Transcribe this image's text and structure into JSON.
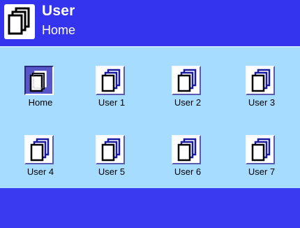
{
  "header": {
    "title": "User",
    "subtitle": "Home",
    "icon": "user-profiles-icon"
  },
  "tiles": [
    {
      "label": "Home",
      "icon": "home-profile-icon",
      "selected": true
    },
    {
      "label": "User 1",
      "icon": "user-profile-icon",
      "selected": false
    },
    {
      "label": "User 2",
      "icon": "user-profile-icon",
      "selected": false
    },
    {
      "label": "User 3",
      "icon": "user-profile-icon",
      "selected": false
    },
    {
      "label": "User 4",
      "icon": "user-profile-icon",
      "selected": false
    },
    {
      "label": "User 5",
      "icon": "user-profile-icon",
      "selected": false
    },
    {
      "label": "User 6",
      "icon": "user-profile-icon",
      "selected": false
    },
    {
      "label": "User 7",
      "icon": "user-profile-icon",
      "selected": false
    }
  ],
  "colors": {
    "header_bg": "#3434ee",
    "content_bg": "#a6dcff",
    "footer_bg": "#3a3af0",
    "selected_tile": "#5656c8"
  }
}
